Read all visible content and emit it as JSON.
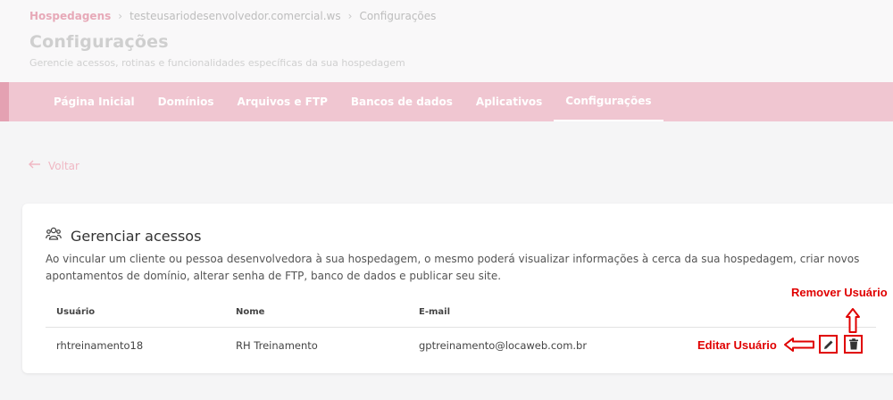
{
  "breadcrumb": {
    "items": [
      "Hospedagens",
      "testeusariodesenvolvedor.comercial.ws",
      "Configurações"
    ]
  },
  "header": {
    "title": "Configurações",
    "subtitle": "Gerencie acessos, rotinas e funcionalidades específicas da sua hospedagem"
  },
  "nav": {
    "tabs": [
      {
        "label": "Página Inicial"
      },
      {
        "label": "Domínios"
      },
      {
        "label": "Arquivos e FTP"
      },
      {
        "label": "Bancos de dados"
      },
      {
        "label": "Aplicativos"
      },
      {
        "label": "Configurações",
        "active": true
      }
    ]
  },
  "back": {
    "label": "Voltar"
  },
  "card": {
    "title": "Gerenciar acessos",
    "description": "Ao vincular um cliente ou pessoa desenvolvedora à sua hospedagem, o mesmo poderá visualizar informações à cerca da sua hospedagem, criar novos apontamentos de domínio, alterar senha de FTP, banco de dados e publicar seu site."
  },
  "table": {
    "columns": [
      "Usuário",
      "Nome",
      "E-mail"
    ],
    "rows": [
      {
        "usuario": "rhtreinamento18",
        "nome": "RH Treinamento",
        "email": "gptreinamento@locaweb.com.br"
      }
    ]
  },
  "annotations": {
    "edit": "Editar Usuário",
    "remove": "Remover Usuário"
  },
  "colors": {
    "brand": "#e4a1b2",
    "annotation": "#e00000"
  },
  "icons": {
    "breadcrumb_sep": "chevron-right-icon",
    "back": "arrow-left-icon",
    "card": "users-icon",
    "edit": "pencil-icon",
    "delete": "trash-icon"
  }
}
